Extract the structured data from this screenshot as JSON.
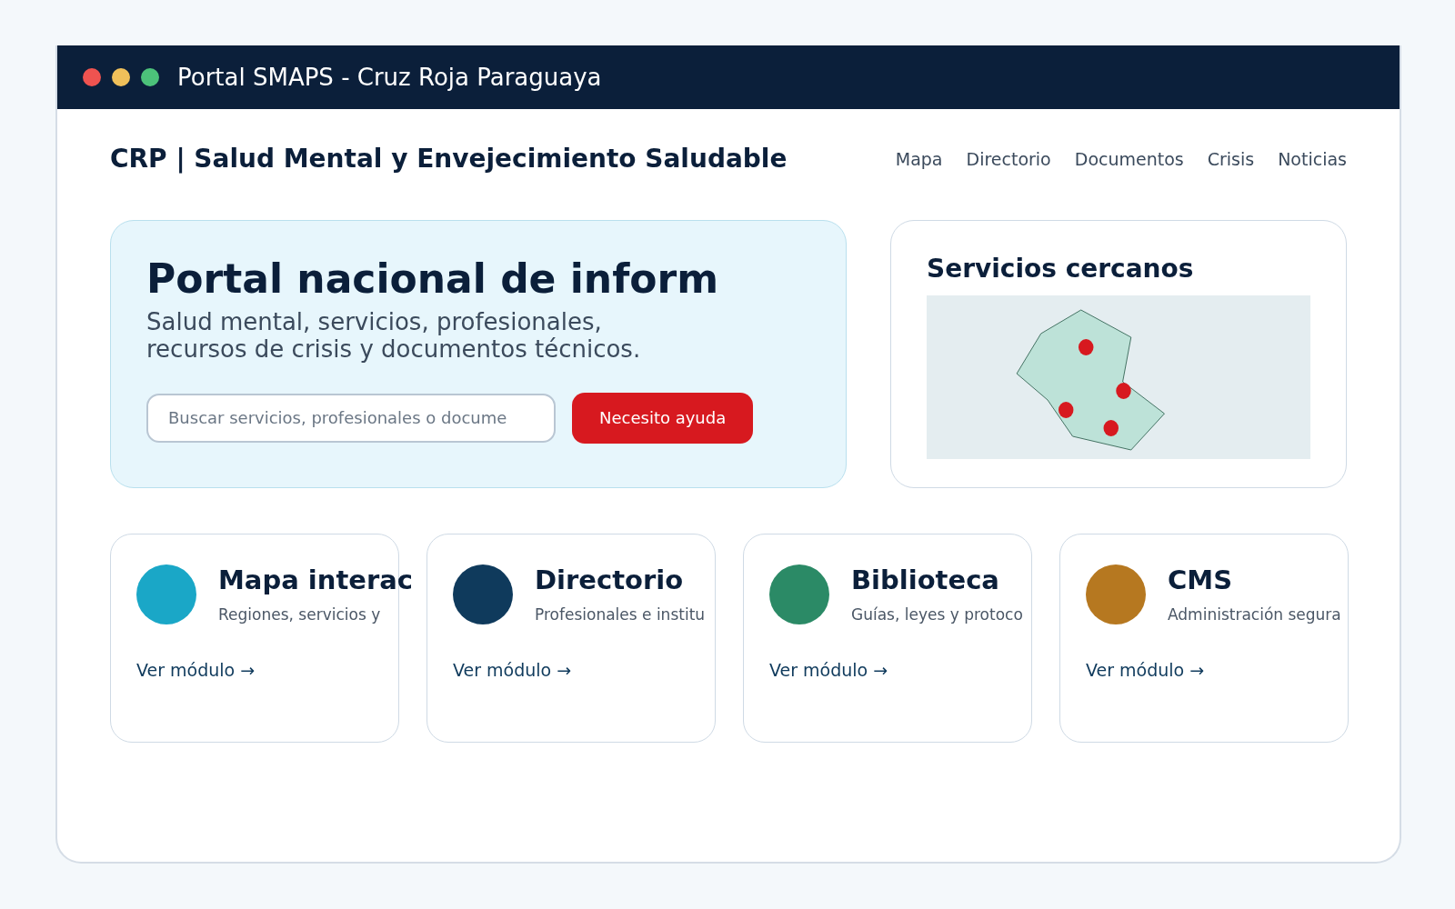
{
  "window": {
    "title": "Portal SMAPS - Cruz Roja Paraguaya"
  },
  "header": {
    "brand": "CRP | Salud Mental y Envejecimiento Saludable",
    "nav": [
      "Mapa",
      "Directorio",
      "Documentos",
      "Crisis",
      "Noticias"
    ]
  },
  "hero": {
    "title": "Portal nacional de inform",
    "subtitle": "Salud mental, servicios, profesionales,\nrecursos de crisis y documentos técnicos.",
    "search": {
      "placeholder": "Buscar servicios, profesionales o docume"
    },
    "help_button": "Necesito ayuda"
  },
  "map_card": {
    "title": "Servicios cercanos"
  },
  "modules": [
    {
      "title": "Mapa interac",
      "description": "Regiones, servicios y",
      "link": "Ver módulo →",
      "color": "#1aa7c7"
    },
    {
      "title": "Directorio",
      "description": "Profesionales e institu",
      "link": "Ver módulo →",
      "color": "#0f3a5c"
    },
    {
      "title": "Biblioteca",
      "description": "Guías, leyes y protoco",
      "link": "Ver módulo →",
      "color": "#2b8a66"
    },
    {
      "title": "CMS",
      "description": "Administración segura",
      "link": "Ver módulo →",
      "color": "#b67820"
    }
  ]
}
